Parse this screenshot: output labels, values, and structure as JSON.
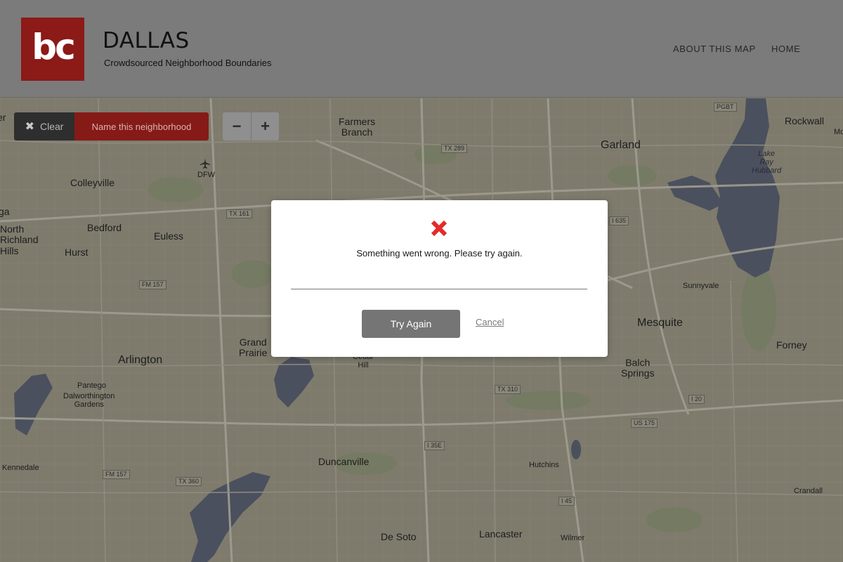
{
  "header": {
    "logo_text": "bc",
    "title": "DALLAS",
    "subtitle": "Crowdsourced Neighborhood Boundaries",
    "nav": [
      "ABOUT THIS MAP",
      "HOME"
    ]
  },
  "toolbar": {
    "clear_icon": "close-icon",
    "clear_label": "Clear",
    "name_label": "Name this neighborhood"
  },
  "zoom": {
    "out_label": "−",
    "in_label": "+"
  },
  "map": {
    "labels": [
      "Farmers\nBranch",
      "Garland",
      "Rockwall",
      "Lake\nRay\nHubbard",
      "Colleyville",
      "DFW",
      "North\nRichland\nHills",
      "Bedford",
      "Euless",
      "Hurst",
      "Sunnyvale",
      "Mesquite",
      "Forney",
      "Grand\nPrairie",
      "Arlington",
      "Pantego",
      "Dalworthington\nGardens",
      "Cedar\nHill",
      "Balch\nSprings",
      "Duncanville",
      "Hutchins",
      "Kennedale",
      "Crandall",
      "De Soto",
      "Lancaster",
      "Wilmer",
      "ga",
      "er",
      "Mc"
    ],
    "highways": [
      "TX 289",
      "PGBT",
      "TX 161",
      "I 635",
      "FM 157",
      "TX 310",
      "I 20",
      "US 175",
      "I 35E",
      "FM 157",
      "TX 360",
      "I 45"
    ]
  },
  "modal": {
    "icon": "close-icon",
    "icon_color": "#e52a2a",
    "message": "Something went wrong. Please try again.",
    "primary_button": "Try Again",
    "secondary_button": "Cancel"
  }
}
